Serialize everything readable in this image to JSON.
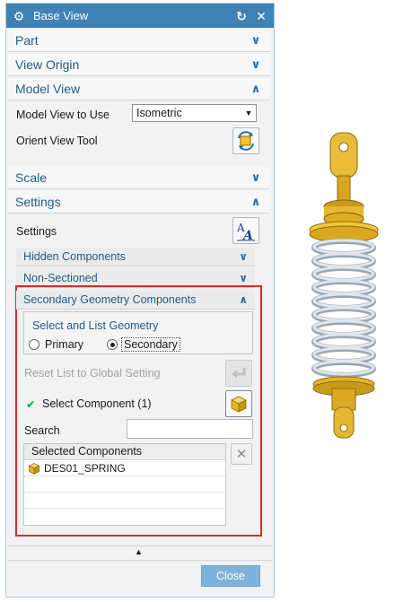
{
  "dialog": {
    "title": "Base View",
    "sections": {
      "part": "Part",
      "view_origin": "View Origin",
      "model_view": "Model View",
      "scale": "Scale",
      "settings": "Settings"
    },
    "model_view": {
      "model_view_to_use_label": "Model View to Use",
      "model_view_value": "Isometric",
      "orient_view_tool_label": "Orient View Tool"
    },
    "settings": {
      "settings_label": "Settings",
      "hidden_components": "Hidden Components",
      "non_sectioned": "Non-Sectioned",
      "secondary_geometry_components": "Secondary Geometry Components"
    },
    "secondary": {
      "group_label": "Select and List Geometry",
      "radio_primary": "Primary",
      "radio_secondary": "Secondary",
      "selected_radio": "Secondary",
      "reset_list_label": "Reset List to Global Setting",
      "select_component_label": "Select Component (1)",
      "search_label": "Search",
      "search_value": "",
      "list_header": "Selected Components",
      "list_items": [
        "DES01_SPRING"
      ]
    },
    "close_label": "Close"
  },
  "colors": {
    "titlebar": "#3f82b4",
    "accent_text": "#235b87",
    "highlight_border": "#d92b2b",
    "close_button": "#7fb3d8",
    "spring": "#c3cdd6",
    "brass": "#d9a820"
  }
}
